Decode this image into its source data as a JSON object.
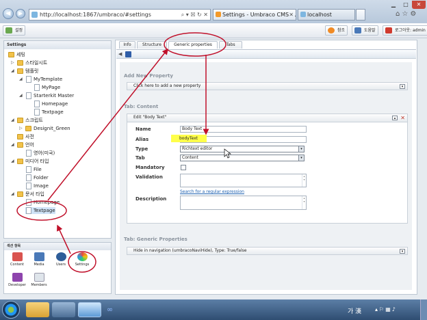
{
  "browser": {
    "url": "http://localhost:1867/umbraco/#settings",
    "tab_active": "Settings - Umbraco CMS - ...",
    "tab_second": "localhost"
  },
  "toolbar": {
    "left_label": "설정",
    "help_label": "참조",
    "help2_label": "도움말",
    "logout_label": "로그아웃: admin"
  },
  "tree": {
    "header": "Settings",
    "items": [
      "세팅",
      "스타일시트",
      "템플릿",
      "MyTemplate",
      "MyPage",
      "Starterkit Master",
      "Homepage",
      "Textpage",
      "스크립트",
      "Designit_Green",
      "사전",
      "언어",
      "영어(미국)",
      "미디어 타입",
      "File",
      "Folder",
      "Image",
      "문서 타입",
      "Homepage",
      "Textpage"
    ]
  },
  "sections": {
    "header": "섹션 항목",
    "items": [
      "Content",
      "Media",
      "Users",
      "Settings",
      "Developer",
      "Members"
    ]
  },
  "tabs": [
    "Info",
    "Structure",
    "Generic properties",
    "Tabs"
  ],
  "editor": {
    "add_new_property": "Add New Property",
    "add_link": "Click here to add a new property",
    "tab_content": "Tab: Content",
    "edit_title": "Edit \"Body Text\"",
    "name_label": "Name",
    "name_value": "Body Text",
    "alias_label": "Alias",
    "alias_value": "bodyText",
    "type_label": "Type",
    "type_value": "Richtext editor",
    "tab_label": "Tab",
    "tab_value": "Content",
    "mandatory_label": "Mandatory",
    "validation_label": "Validation",
    "regex_link": "Search for a regular expression",
    "description_label": "Description",
    "tab_generic": "Tab: Generic Properties",
    "hide_nav": "Hide in navigation (umbracoNaviHide), Type: True/false"
  },
  "taskbar": {
    "ime": "가 漢"
  },
  "colors": {
    "highlight": "#ffff4a",
    "annotation": "#c0102a"
  }
}
